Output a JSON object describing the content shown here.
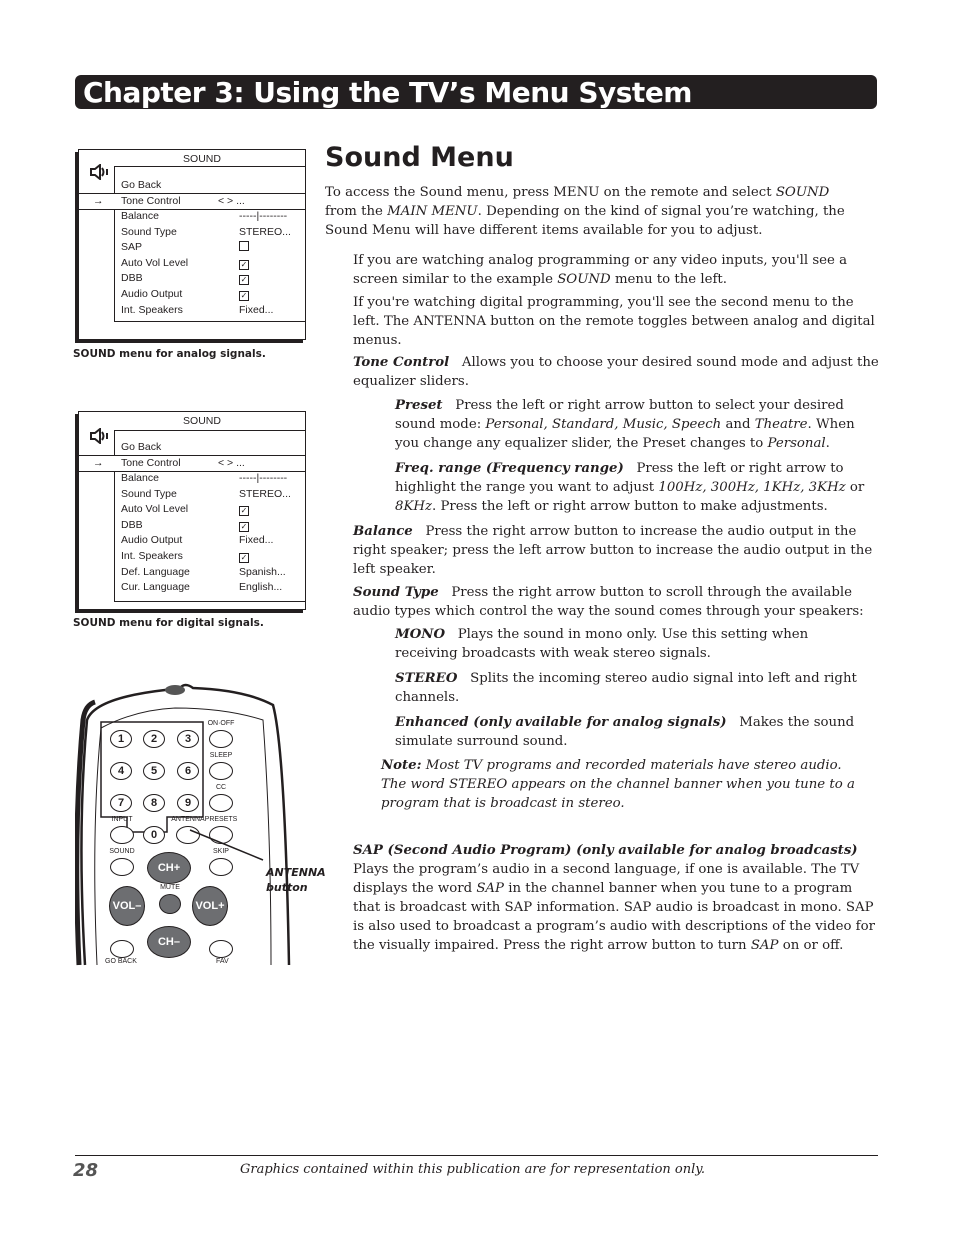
{
  "header": {
    "chapter_title": "Chapter 3: Using the TV’s Menu System"
  },
  "analog_menu": {
    "title": "SOUND",
    "icon": "speaker-icon",
    "go_back": "Go Back",
    "selected_arrow": "→",
    "selected": {
      "label": "Tone Control",
      "value": "< > ..."
    },
    "rows": [
      {
        "label": "Balance",
        "value": "-----|--------"
      },
      {
        "label": "Sound Type",
        "value": "STEREO..."
      },
      {
        "label": "SAP",
        "value": "",
        "checkbox": false
      },
      {
        "label": "Auto Vol Level",
        "value": "",
        "checkbox": true
      },
      {
        "label": "DBB",
        "value": "",
        "checkbox": true
      },
      {
        "label": "Audio Output",
        "value": "",
        "checkbox": true
      },
      {
        "label": "Int. Speakers",
        "value": "Fixed..."
      }
    ],
    "caption": "SOUND menu for analog signals."
  },
  "digital_menu": {
    "title": "SOUND",
    "icon": "speaker-icon",
    "go_back": "Go Back",
    "selected_arrow": "→",
    "selected": {
      "label": "Tone Control",
      "value": "< > ..."
    },
    "rows": [
      {
        "label": "Balance",
        "value": "-----|--------"
      },
      {
        "label": "Sound Type",
        "value": "STEREO..."
      },
      {
        "label": "Auto Vol Level",
        "value": "",
        "checkbox": true
      },
      {
        "label": "DBB",
        "value": "",
        "checkbox": true
      },
      {
        "label": "Audio Output",
        "value": "Fixed..."
      },
      {
        "label": "Int. Speakers",
        "value": "",
        "checkbox": true
      },
      {
        "label": "Def. Language",
        "value": "Spanish..."
      },
      {
        "label": "Cur. Language",
        "value": "English..."
      }
    ],
    "caption": "SOUND menu for digital signals."
  },
  "remote": {
    "number_buttons": [
      "1",
      "2",
      "3",
      "4",
      "5",
      "6",
      "7",
      "8",
      "9",
      "0"
    ],
    "labels": {
      "on_off": "ON·OFF",
      "sleep": "SLEEP",
      "cc": "CC",
      "input": "INPUT",
      "antenna": "ANTENNA",
      "presets": "PRESETS",
      "sound": "SOUND",
      "skip": "SKIP",
      "ch_up": "CH+",
      "ch_down": "CH–",
      "vol_down": "VOL–",
      "vol_up": "VOL+",
      "mute": "MUTE",
      "go_back": "GO BACK",
      "fav": "FAV"
    },
    "callout_line1": "ANTENNA",
    "callout_line2": "button"
  },
  "main": {
    "title": "Sound Menu",
    "intro": {
      "p1": "To access the Sound menu, press MENU on the remote and select ",
      "p1_i1": "SOUND",
      "p2": " from the ",
      "p2_i": "MAIN MENU",
      "p3": ". Depending on the kind of signal you’re watching, the Sound Menu will have different items available for you to adjust."
    },
    "analog_para": {
      "a": "If you are watching analog programming or any video inputs, you'll see a screen similar to the example ",
      "i": "SOUND",
      "b": " menu to the left."
    },
    "digital_para": "If you're watching digital programming, you'll see the second menu to the left. The ANTENNA button on the remote toggles between analog and digital menus.",
    "tone_control": {
      "term": "Tone Control",
      "desc": "Allows you to choose your desired sound mode and adjust the equalizer sliders."
    },
    "preset": {
      "term": "Preset",
      "a": "Press the left or right arrow button to select your desired sound mode: ",
      "i1": "Personal, Standard, Music, Speech",
      "b": " and ",
      "i2": "Theatre",
      "c": ". When you change any equalizer slider, the Preset changes to ",
      "i3": "Personal",
      "d": "."
    },
    "freq": {
      "term": "Freq. range (Frequency range)",
      "a": "Press the left or right arrow to highlight the range you want to adjust ",
      "i1": "100Hz, 300Hz, 1KHz, 3KHz",
      "b": " or ",
      "i2": "8KHz",
      "c": ". Press the left or right arrow button to make adjustments."
    },
    "balance": {
      "term": "Balance",
      "desc": "Press the right arrow button to increase the audio output in the right speaker; press the left arrow button to increase the audio output in the left speaker."
    },
    "sound_type": {
      "term": "Sound Type",
      "desc": "Press the right arrow button to scroll through the available audio types which control the way the sound comes through your speakers:"
    },
    "mono": {
      "term": "MONO",
      "desc": "Plays the sound in mono only. Use this setting when receiving broadcasts with weak stereo signals."
    },
    "stereo": {
      "term": "STEREO",
      "desc": "Splits the incoming stereo audio signal into left and right channels."
    },
    "enhanced": {
      "term": "Enhanced (only available for analog signals)",
      "desc": "Makes the sound simulate surround sound."
    },
    "note": {
      "term": "Note:",
      "desc": "Most TV programs and recorded materials have stereo audio. The word STEREO appears on the channel banner when you tune to a program that is broadcast in stereo."
    },
    "sap": {
      "term": "SAP (Second Audio Program) (only available for analog broadcasts)",
      "a": "Plays the program’s audio in a second language, if one is available. The TV displays the word ",
      "i1": "SAP",
      "b": " in the channel banner when you tune to a program that is broadcast with SAP information. SAP audio is broadcast in mono. SAP is also used to broadcast a program’s audio with descriptions of the video for the visually impaired. Press the right arrow button to turn ",
      "i2": "SAP",
      "c": " on or off."
    }
  },
  "footer": {
    "page_number": "28",
    "note": "Graphics contained within this publication are for representation only."
  }
}
